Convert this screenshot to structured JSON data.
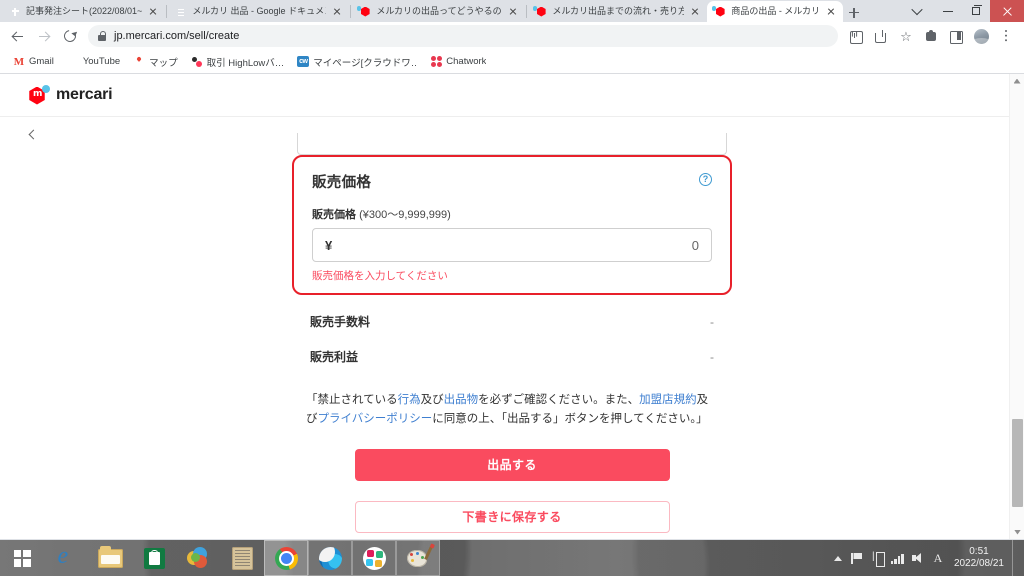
{
  "window": {
    "controls": {
      "tab_search": "tab-search-chevron",
      "minimize": "minimize",
      "maximize": "restore",
      "close": "close"
    }
  },
  "tabs": [
    {
      "title": "記事発注シート(2022/08/01~",
      "favicon": "google-sheets-icon",
      "active": false
    },
    {
      "title": "メルカリ 出品 - Google ドキュメン",
      "favicon": "google-docs-icon",
      "active": false
    },
    {
      "title": "メルカリの出品ってどうやるの？初",
      "favicon": "mercari-icon",
      "active": false
    },
    {
      "title": "メルカリ出品までの流れ・売り方 -",
      "favicon": "mercari-icon",
      "active": false
    },
    {
      "title": "商品の出品 - メルカリ",
      "favicon": "mercari-icon",
      "active": true
    }
  ],
  "new_tab_label": "+",
  "toolbar": {
    "back": "back-arrow",
    "forward": "forward-arrow",
    "reload": "reload",
    "url_secure": "jp.mercari.com",
    "url_path": "/sell/create",
    "url_full": "jp.mercari.com/sell/create",
    "lock": "lock-icon",
    "right_icons": [
      "install-icon",
      "share-icon",
      "bookmark-star-icon",
      "extensions-icon",
      "sidebar-icon",
      "profile-avatar",
      "chrome-menu-icon"
    ]
  },
  "bookmarks": [
    {
      "label": "Gmail",
      "icon": "gmail-icon"
    },
    {
      "label": "YouTube",
      "icon": "youtube-icon"
    },
    {
      "label": "マップ",
      "icon": "google-maps-icon"
    },
    {
      "label": "取引 HighLowバ…",
      "icon": "highlow-icon"
    },
    {
      "label": "マイページ[クラウドワ…",
      "icon": "crowdworks-icon"
    },
    {
      "label": "Chatwork",
      "icon": "chatwork-icon"
    }
  ],
  "site": {
    "logo_text": "mercari",
    "logo_mark": "mercari-hexagon-logo",
    "back_button": "back-chevron-icon"
  },
  "form": {
    "section_title": "販売価格",
    "help_icon_label": "?",
    "price_label_bold": "販売価格",
    "price_label_range": "(¥300〜9,999,999)",
    "currency_symbol": "¥",
    "price_value": "0",
    "price_placeholder": "",
    "error_message": "販売価格を入力してください",
    "rows": [
      {
        "label": "販売手数料",
        "value": "-"
      },
      {
        "label": "販売利益",
        "value": "-"
      }
    ],
    "terms_parts": [
      {
        "text": "「禁止されている",
        "link": false
      },
      {
        "text": "行為",
        "link": true
      },
      {
        "text": "及び",
        "link": false
      },
      {
        "text": "出品物",
        "link": true
      },
      {
        "text": "を必ずご確認ください。また、",
        "link": false
      },
      {
        "text": "加盟店規約",
        "link": true
      },
      {
        "text": "及び",
        "link": false
      },
      {
        "text": "プライバシーポリシー",
        "link": true
      },
      {
        "text": "に同意の上、「出品する」ボタンを押してください。」",
        "link": false
      }
    ],
    "submit_label": "出品する",
    "draft_label": "下書きに保存する",
    "accent_color": "#fa4b5f",
    "highlight_color": "#e8202a"
  },
  "scrollbar": {
    "name": "vertical-scrollbar"
  },
  "taskbar": {
    "start_label": "start-button",
    "apps": [
      {
        "icon": "internet-explorer-icon",
        "state": "idle"
      },
      {
        "icon": "file-explorer-icon",
        "state": "idle"
      },
      {
        "icon": "microsoft-store-icon",
        "state": "idle"
      },
      {
        "icon": "paint-3d-icon",
        "state": "idle"
      },
      {
        "icon": "document-icon",
        "state": "idle"
      },
      {
        "icon": "google-chrome-icon",
        "state": "active"
      },
      {
        "icon": "microsoft-edge-icon",
        "state": "open"
      },
      {
        "icon": "slack-icon",
        "state": "open"
      },
      {
        "icon": "paint-icon",
        "state": "open"
      }
    ],
    "tray_icons": [
      "show-hidden-icons-caret",
      "flag-notification-icon",
      "ime-mode-icon",
      "network-icon",
      "volume-icon",
      "ime-alpha-icon"
    ],
    "clock_time": "0:51",
    "clock_date": "2022/08/21"
  }
}
